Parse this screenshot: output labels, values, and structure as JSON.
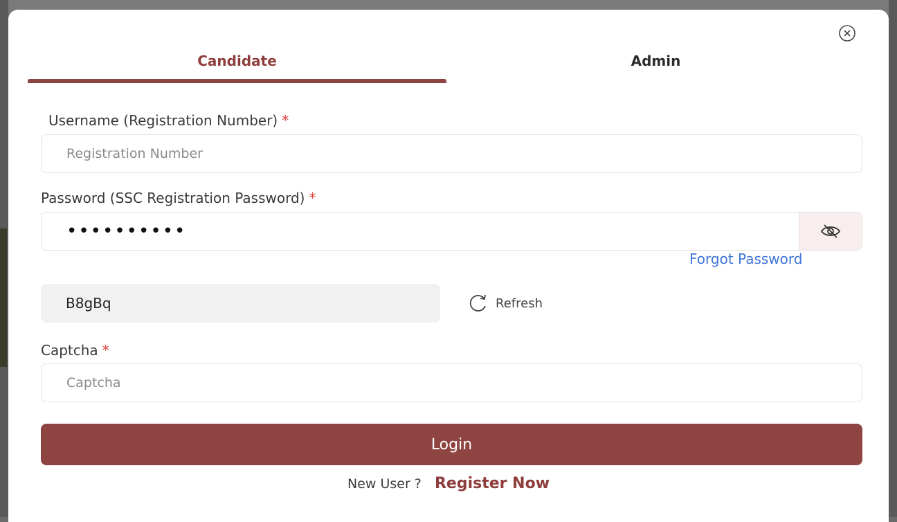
{
  "tabs": [
    {
      "label": "Candidate",
      "active": true
    },
    {
      "label": "Admin",
      "active": false
    }
  ],
  "form": {
    "username": {
      "label": "Username (Registration Number)",
      "required_mark": "*",
      "placeholder": "Registration Number",
      "value": ""
    },
    "password": {
      "label": "Password (SSC Registration Password)",
      "required_mark": "*",
      "value": "••••••••••",
      "toggle_icon": "eye-slash-icon"
    },
    "forgot_password": "Forgot Password",
    "captcha_code": "B8gBq",
    "refresh_label": "Refresh",
    "captcha": {
      "label": "Captcha",
      "required_mark": "*",
      "placeholder": "Captcha",
      "value": ""
    },
    "login_label": "Login"
  },
  "footer": {
    "prompt": "New User ?",
    "register_label": "Register Now"
  },
  "colors": {
    "accent": "#8e4441",
    "link": "#3f74d8",
    "required": "#e0453f"
  }
}
